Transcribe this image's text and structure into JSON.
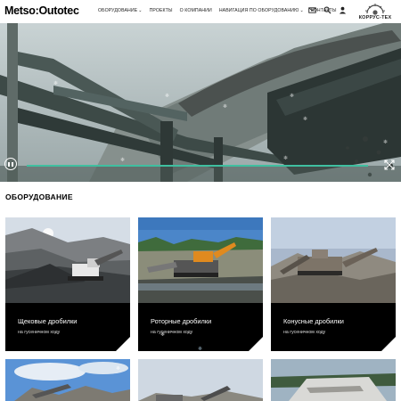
{
  "header": {
    "logo": "Metso:Outotec",
    "nav": [
      {
        "label": "ОБОРУДОВАНИЕ",
        "has_dropdown": true
      },
      {
        "label": "ПРОЕКТЫ",
        "has_dropdown": false
      },
      {
        "label": "О КОМПАНИИ",
        "has_dropdown": false
      },
      {
        "label": "НАВИГАЦИЯ ПО ОБОРУДОВАНИЮ",
        "has_dropdown": true
      },
      {
        "label": "КОНТАКТЫ",
        "has_dropdown": false
      }
    ],
    "chevron": "⌄",
    "icons": [
      "mail-icon",
      "search-icon",
      "user-icon"
    ],
    "partner_logo": "КОРРУС-ТЕХ"
  },
  "hero": {
    "video_progress": 1.0,
    "accent_color": "#3fbfa0"
  },
  "section": {
    "title": "ОБОРУДОВАНИЕ"
  },
  "cards": [
    {
      "title": "Щековые дробилки",
      "subtitle": "на гусеничном ходу"
    },
    {
      "title": "Роторные дробилки",
      "subtitle": "на гусеничном ходу"
    },
    {
      "title": "Конусные дробилки",
      "subtitle": "на гусеничном ходу"
    }
  ]
}
